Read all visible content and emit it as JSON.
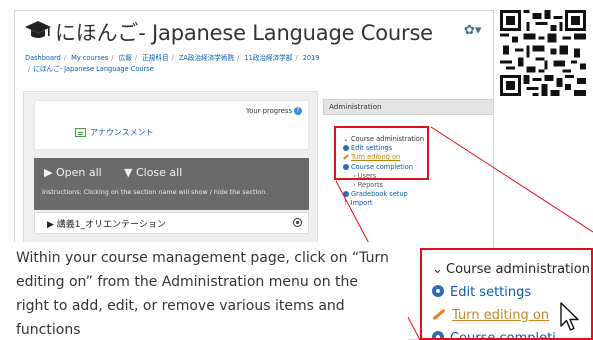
{
  "course": {
    "title": "にほんご- Japanese Language Course",
    "breadcrumb": [
      "Dashboard",
      "My courses",
      "広報",
      "正規科目",
      "ZA政治経済学術院",
      "11政治経済学部",
      "2019",
      "にほんご- Japanese Language Course"
    ]
  },
  "main": {
    "progress_label": "Your progress",
    "progress_help": "?",
    "announcement": "アナウンスメント",
    "open_all": "▶ Open all",
    "close_all": "▼ Close all",
    "instructions": "Instructions: Clicking on the section name will show / hide the section.",
    "section_title": "▶ 講義1_オリエンテーション"
  },
  "admin": {
    "header": "Administration",
    "items": [
      {
        "label": "Course administration"
      },
      {
        "label": "Edit settings"
      },
      {
        "label": "Turn editing on"
      },
      {
        "label": "Course completion"
      },
      {
        "label": "Users"
      },
      {
        "label": "Reports"
      },
      {
        "label": "Gradebook setup"
      },
      {
        "label": "Import"
      }
    ]
  },
  "zoom": {
    "items": [
      {
        "label": "Course administration"
      },
      {
        "label": "Edit settings"
      },
      {
        "label": "Turn editing on"
      },
      {
        "label": "Course completi"
      }
    ]
  },
  "caption": "Within your course management page, click on “Turn editing on” from the Administration menu on the right to add, edit, or remove various items and functions",
  "colors": {
    "accent_red": "#e0101a",
    "link_blue": "#0a5cab",
    "turn_editing": "#c9862a"
  }
}
